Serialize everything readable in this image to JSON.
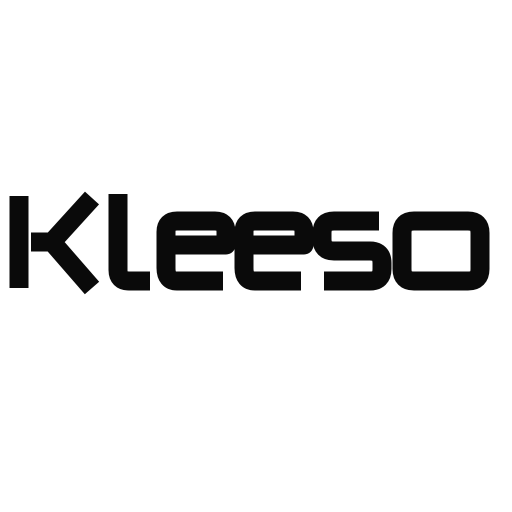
{
  "logo": {
    "wordmark": "Kleeso",
    "color": "#0a0a0a",
    "background": "#ffffff"
  }
}
